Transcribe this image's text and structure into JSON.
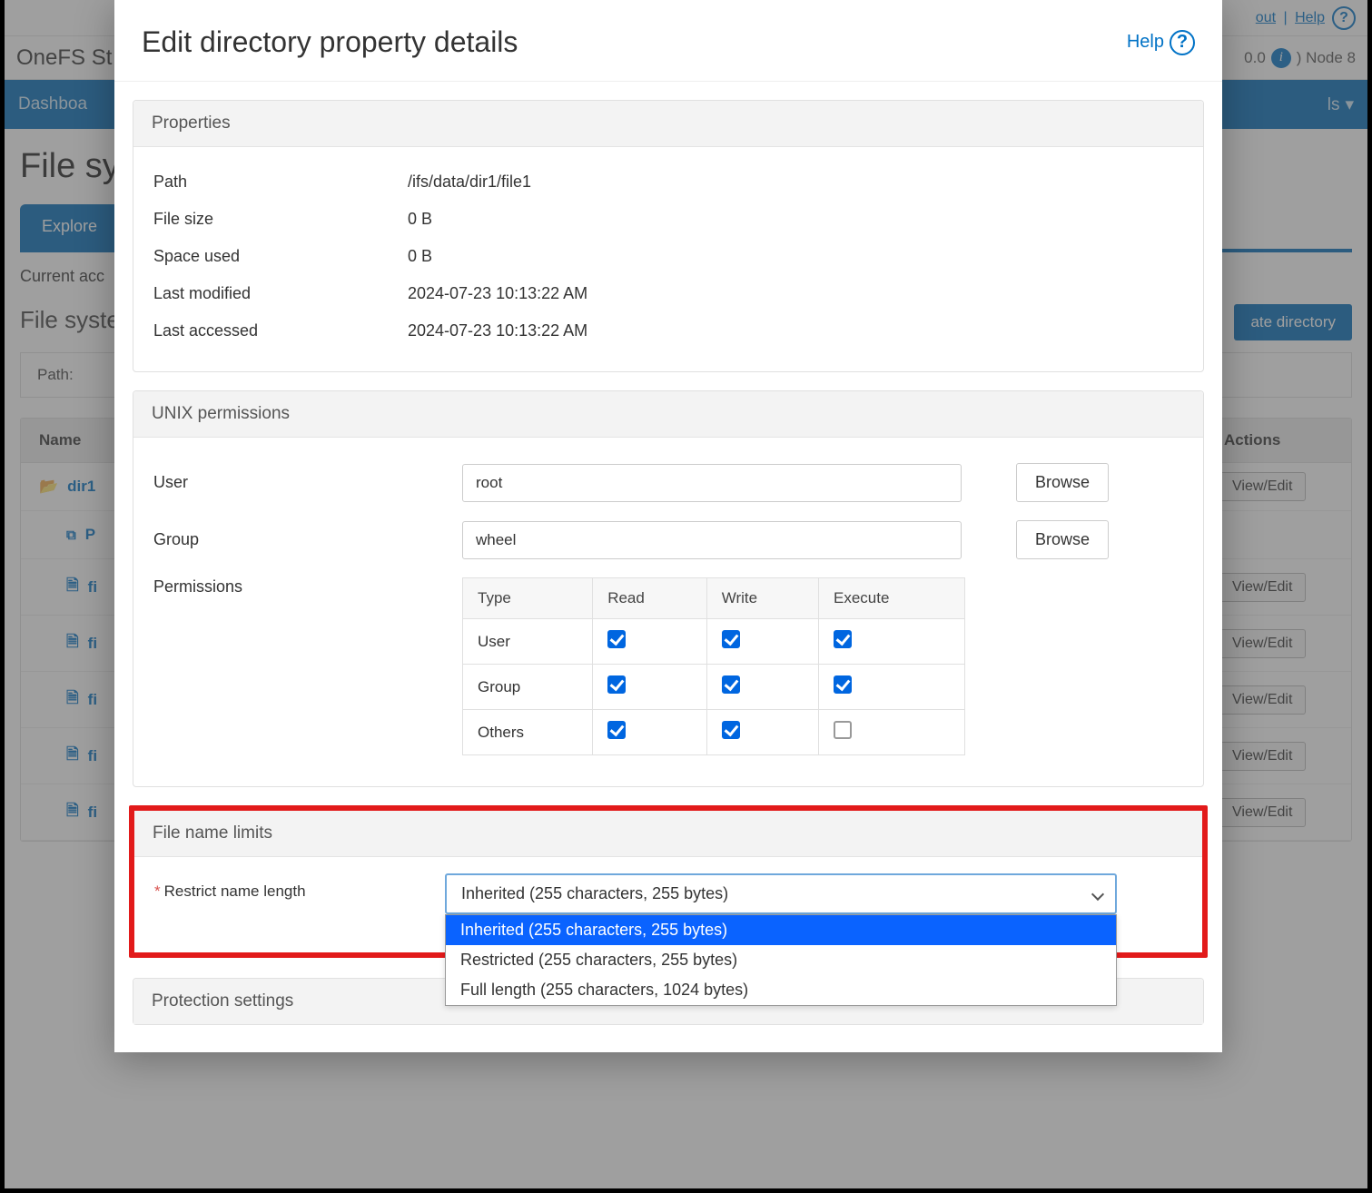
{
  "background": {
    "topbar": {
      "logout": "out",
      "help": "Help"
    },
    "brand": "OneFS St",
    "version_suffix": "0.0",
    "node": ") Node 8",
    "nav_dashboard": "Dashboa",
    "nav_right": "ls",
    "heading": "File sy",
    "tab_explore": "Explore",
    "current_access": "Current acc",
    "subheading": "File syste",
    "create_dir": "ate directory",
    "path_label": "Path:",
    "table": {
      "col_name": "Name",
      "col_actions": "Actions",
      "rows": [
        {
          "icon": "folder-open",
          "name": "dir1",
          "indent": 0
        },
        {
          "icon": "tree",
          "name": "P",
          "indent": 1
        },
        {
          "icon": "file",
          "name": "fi",
          "indent": 1
        },
        {
          "icon": "file",
          "name": "fi",
          "indent": 1
        },
        {
          "icon": "file",
          "name": "fi",
          "indent": 1
        },
        {
          "icon": "file",
          "name": "fi",
          "indent": 1
        },
        {
          "icon": "file",
          "name": "fi",
          "indent": 1
        }
      ],
      "view_edit": "View/Edit"
    }
  },
  "modal": {
    "title": "Edit directory property details",
    "help": "Help",
    "properties": {
      "heading": "Properties",
      "path_label": "Path",
      "path_value": "/ifs/data/dir1/file1",
      "filesize_label": "File size",
      "filesize_value": "0 B",
      "spaceused_label": "Space used",
      "spaceused_value": "0 B",
      "lastmod_label": "Last modified",
      "lastmod_value": "2024-07-23 10:13:22 AM",
      "lastacc_label": "Last accessed",
      "lastacc_value": "2024-07-23 10:13:22 AM"
    },
    "unix": {
      "heading": "UNIX permissions",
      "user_label": "User",
      "user_value": "root",
      "group_label": "Group",
      "group_value": "wheel",
      "browse": "Browse",
      "perm_label": "Permissions",
      "th_type": "Type",
      "th_read": "Read",
      "th_write": "Write",
      "th_exec": "Execute",
      "rows": [
        {
          "type": "User",
          "read": true,
          "write": true,
          "execute": true
        },
        {
          "type": "Group",
          "read": true,
          "write": true,
          "execute": true
        },
        {
          "type": "Others",
          "read": true,
          "write": true,
          "execute": false
        }
      ]
    },
    "limits": {
      "heading": "File name limits",
      "field_label": "Restrict name length",
      "selected": "Inherited (255 characters, 255 bytes)",
      "options": [
        "Inherited (255 characters, 255 bytes)",
        "Restricted (255 characters, 255 bytes)",
        "Full length (255 characters, 1024 bytes)"
      ]
    },
    "protection_heading": "Protection settings"
  }
}
